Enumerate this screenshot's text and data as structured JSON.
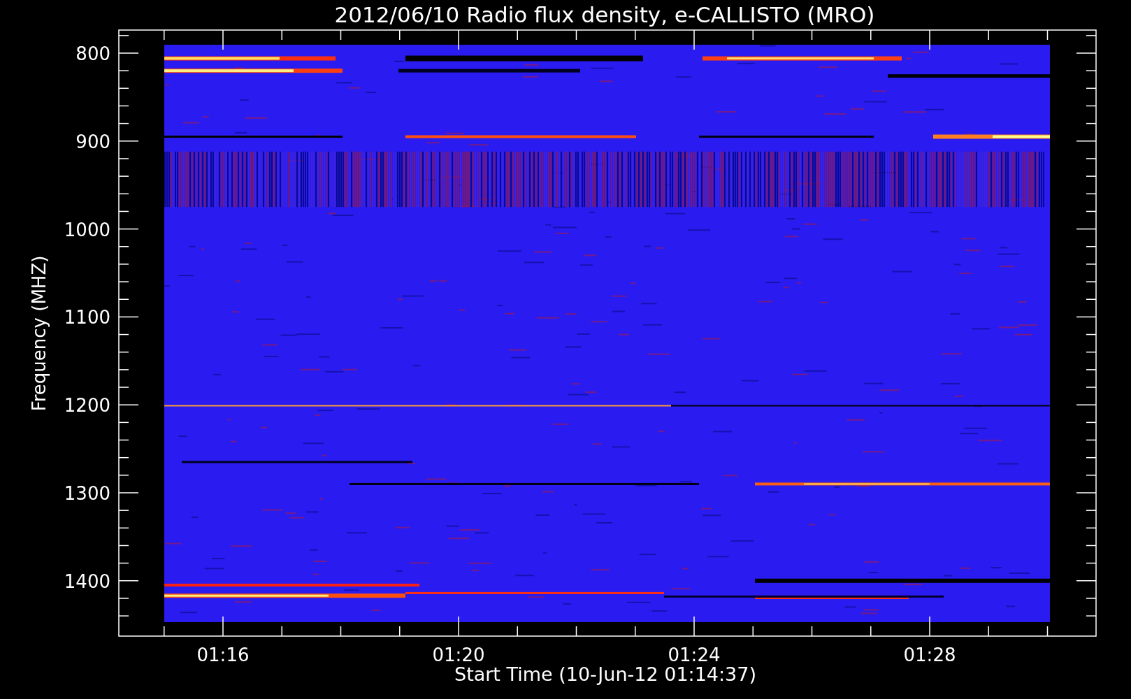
{
  "title": "2012/06/10  Radio flux density, e-CALLISTO (MRO)",
  "y_axis": {
    "label": "Frequency (MHZ)",
    "ticks": [
      "800",
      "900",
      "1000",
      "1100",
      "1200",
      "1300",
      "1400"
    ]
  },
  "x_axis": {
    "label": "Start Time (10-Jun-12 01:14:37)",
    "ticks": [
      "01:16",
      "01:20",
      "01:24",
      "01:28"
    ]
  }
}
